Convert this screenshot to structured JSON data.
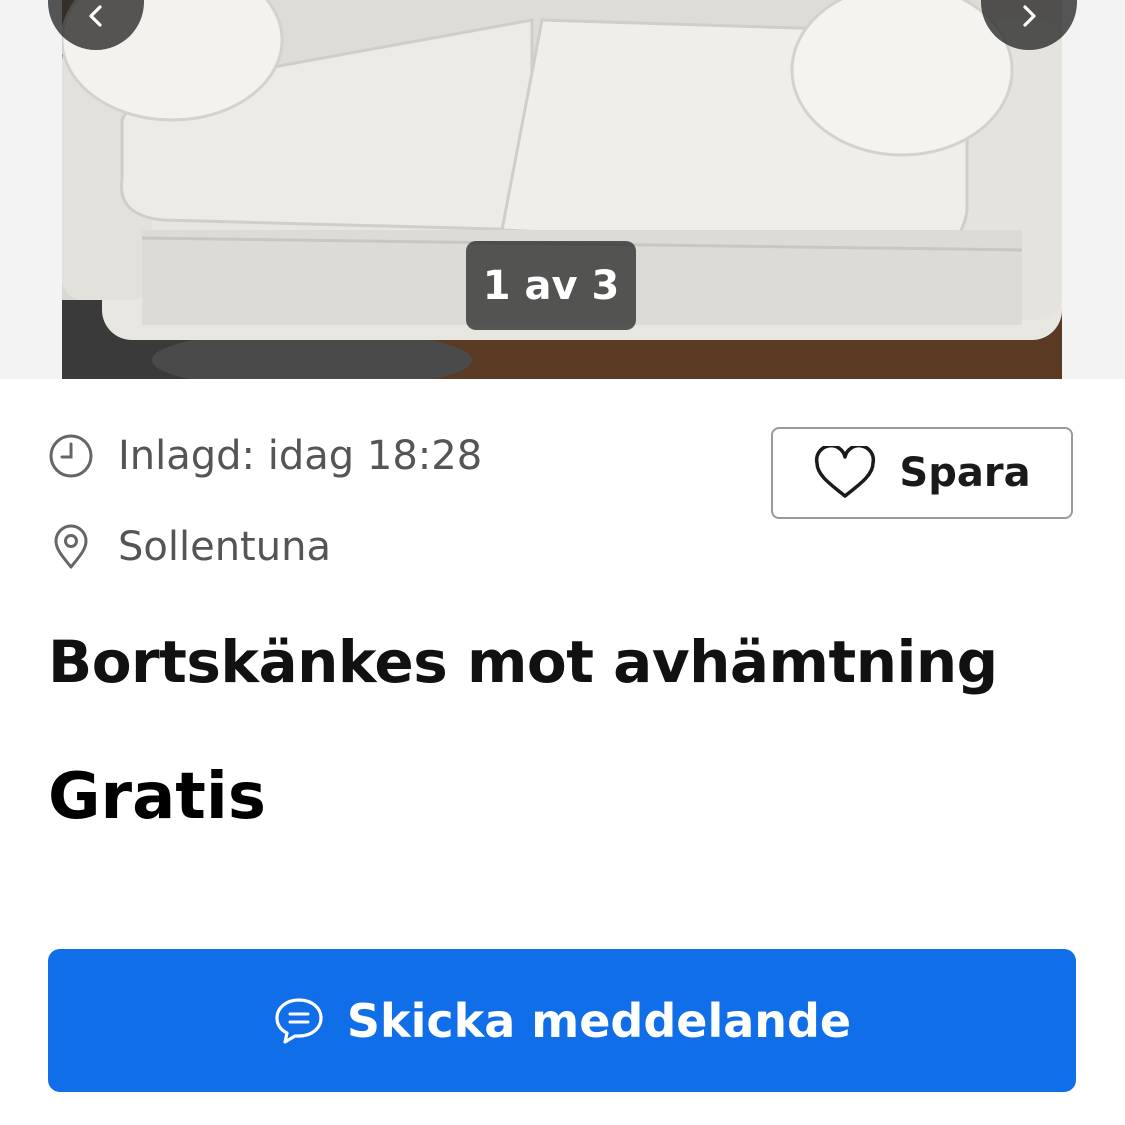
{
  "gallery": {
    "counter": "1 av 3",
    "prev_icon": "chevron-left-icon",
    "next_icon": "chevron-right-icon"
  },
  "listing": {
    "posted_label": "Inlagd: idag 18:28",
    "location": "Sollentuna",
    "title": "Bortskänkes mot avhämtning",
    "price": "Gratis"
  },
  "actions": {
    "save_label": "Spara",
    "message_label": "Skicka meddelande"
  },
  "colors": {
    "primary": "#0f6ee8",
    "text": "#111111",
    "muted": "#555555"
  }
}
